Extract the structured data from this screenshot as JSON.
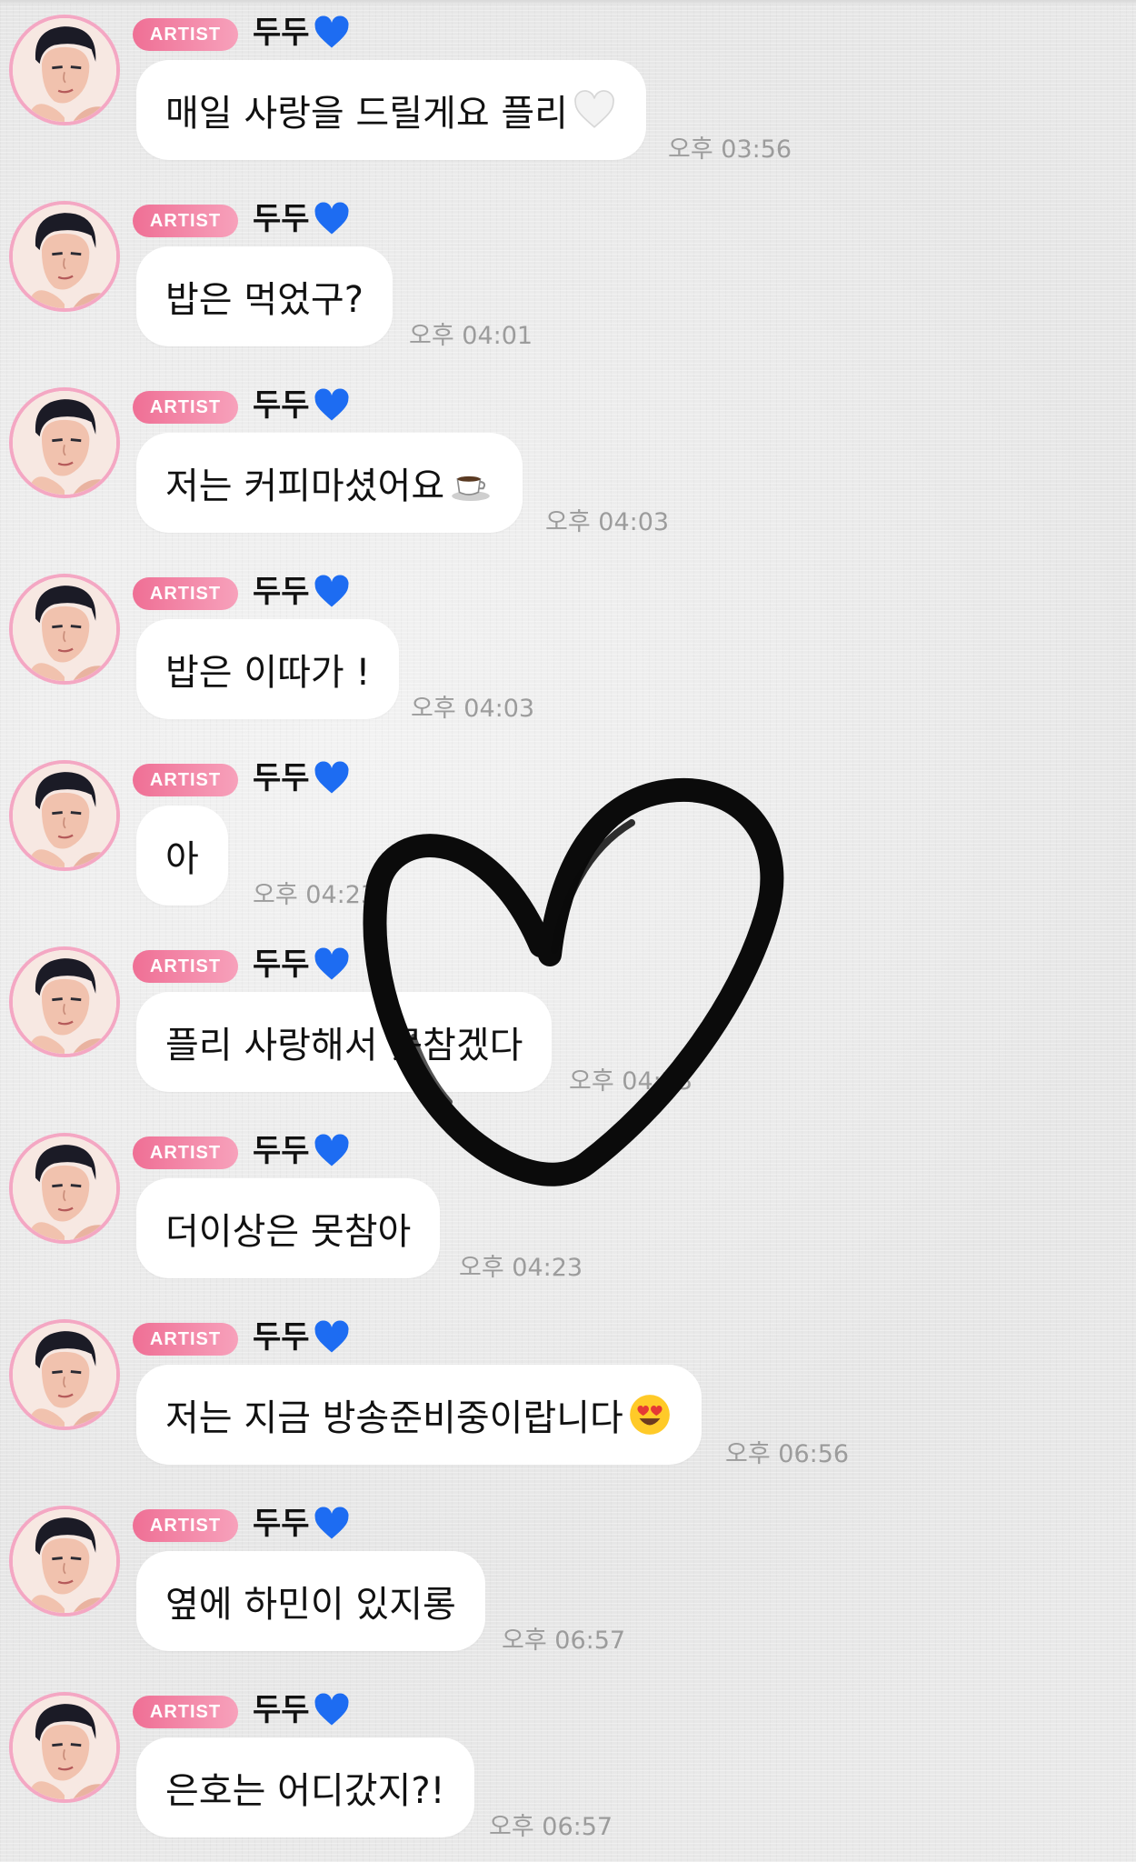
{
  "badge_label": "ARTIST",
  "sender_name": "두두",
  "icons": {
    "sender_suffix": "blue-heart-icon",
    "avatar": "artist-avatar",
    "overlay": "hand-drawn-heart"
  },
  "colors": {
    "badge": "#ef6f95",
    "avatar_ring": "#f4a7c3",
    "timestamp": "#9c9c9c",
    "blue_heart": "#1d6cf2",
    "background": "#ebebeb"
  },
  "messages": [
    {
      "text": "매일 사랑을 드릴게요 플리",
      "emoji": "white-heart-icon",
      "time": "오후 03:56"
    },
    {
      "text": "밥은 먹었구?",
      "emoji": "",
      "time": "오후 04:01"
    },
    {
      "text": "저는 커피마셨어요",
      "emoji": "coffee-icon",
      "time": "오후 04:03"
    },
    {
      "text": "밥은 이따가 !",
      "emoji": "",
      "time": "오후 04:03"
    },
    {
      "text": "아",
      "emoji": "",
      "time": "오후 04:23"
    },
    {
      "text": "플리 사랑해서 못참겠다",
      "emoji": "",
      "time": "오후 04:23"
    },
    {
      "text": "더이상은 못참아",
      "emoji": "",
      "time": "오후 04:23"
    },
    {
      "text": "저는 지금 방송준비중이랍니다",
      "emoji": "heart-eyes-icon",
      "time": "오후 06:56"
    },
    {
      "text": "옆에 하민이 있지롱",
      "emoji": "",
      "time": "오후 06:57"
    },
    {
      "text": "은호는 어디갔지?!",
      "emoji": "",
      "time": "오후 06:57"
    }
  ]
}
